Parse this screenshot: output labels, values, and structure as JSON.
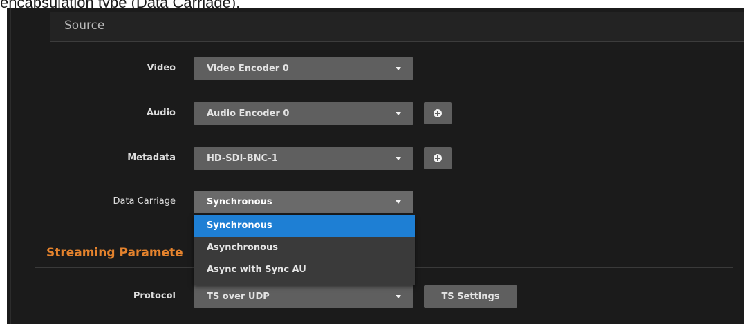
{
  "caption": "encapsulation type (Data Carriage).",
  "source": {
    "title": "Source",
    "video": {
      "label": "Video",
      "value": "Video Encoder 0"
    },
    "audio": {
      "label": "Audio",
      "value": "Audio Encoder 0"
    },
    "metadata": {
      "label": "Metadata",
      "value": "HD-SDI-BNC-1"
    },
    "data_carriage": {
      "label": "Data Carriage",
      "value": "Synchronous",
      "options": [
        "Synchronous",
        "Asynchronous",
        "Async with Sync AU"
      ]
    }
  },
  "streaming": {
    "title": "Streaming Paramete",
    "protocol": {
      "label": "Protocol",
      "value": "TS over UDP"
    },
    "ts_settings_label": "TS Settings"
  },
  "colors": {
    "accent_orange": "#e5832d",
    "highlight_blue": "#1e7fd4",
    "panel_bg": "#1b1b1b",
    "control_bg": "#5f5f5f"
  },
  "icons": {
    "select_caret": "chevron-down-icon",
    "add_button": "plus-circle-icon"
  }
}
